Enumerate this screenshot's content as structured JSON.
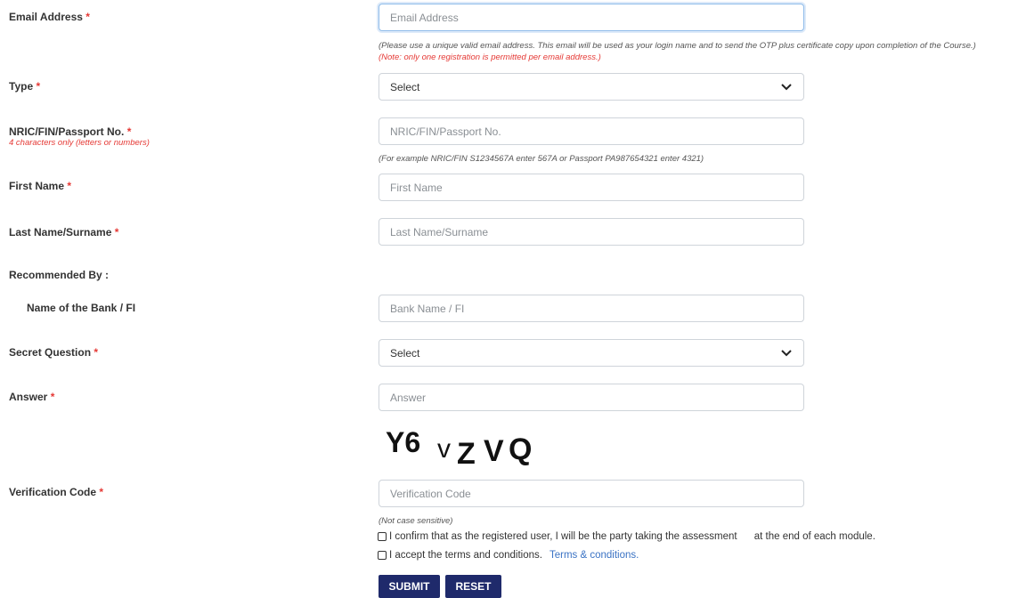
{
  "required_mark": "*",
  "fields": {
    "email": {
      "label": "Email Address",
      "placeholder": "Email Address",
      "hint": "(Please use a unique valid email address. This email will be used as your login name and to send the OTP plus certificate copy upon completion of the Course.)",
      "note": "(Note: only one registration is permitted per email address.)"
    },
    "type": {
      "label": "Type",
      "selected": "Select"
    },
    "nric": {
      "label": "NRIC/FIN/Passport No.",
      "sublabel": "4 characters only (letters or numbers)",
      "placeholder": "NRIC/FIN/Passport No.",
      "hint": "(For example NRIC/FIN S1234567A enter 567A or Passport PA987654321 enter 4321)"
    },
    "first_name": {
      "label": "First Name",
      "placeholder": "First Name"
    },
    "last_name": {
      "label": "Last Name/Surname",
      "placeholder": "Last Name/Surname"
    },
    "recommended_by": {
      "label": "Recommended By :"
    },
    "bank": {
      "label": "Name of the Bank / FI",
      "placeholder": "Bank Name / FI"
    },
    "secret_question": {
      "label": "Secret Question",
      "selected": "Select"
    },
    "answer": {
      "label": "Answer",
      "placeholder": "Answer"
    },
    "captcha": {
      "text": "Y6 v Z V Q"
    },
    "verification": {
      "label": "Verification Code",
      "placeholder": "Verification Code",
      "hint": "(Not case sensitive)"
    }
  },
  "checkboxes": {
    "confirm": {
      "label": "I confirm that as the registered user, I will be the party taking the assessment      at the end of each module.",
      "checked": false
    },
    "terms": {
      "label": "I accept the terms and conditions.",
      "link": "Terms & conditions.",
      "checked": false
    }
  },
  "buttons": {
    "submit": "SUBMIT",
    "reset": "RESET"
  },
  "icons": {
    "select_arrow": "chevron-down-icon"
  }
}
